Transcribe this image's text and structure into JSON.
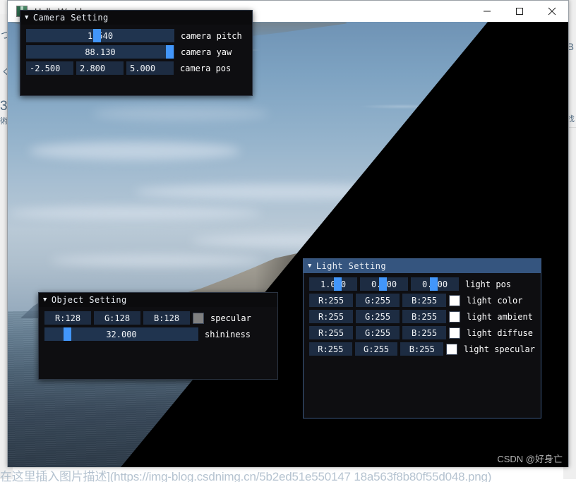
{
  "window": {
    "title": "Hello World",
    "icon": "app-icon",
    "buttons": {
      "minimize": "minimize-icon",
      "maximize": "maximize-icon",
      "close": "close-icon"
    }
  },
  "watermark": "CSDN @好身亡",
  "bottom_caption": "在这里插入图片描述](https://img-blog.csdnimg.cn/5b2ed51e550147 18a563f8b80f55d048.png)",
  "panels": {
    "camera": {
      "title": "Camera Setting",
      "collapse_icon": "triangle-down-icon",
      "rows": [
        {
          "type": "slider",
          "value": "1.540",
          "grab_pct": 45,
          "label": "camera pitch"
        },
        {
          "type": "slider",
          "value": "88.130",
          "grab_pct": 96,
          "label": "camera yaw"
        },
        {
          "type": "fields3",
          "values": [
            "-2.500",
            "2.800",
            "5.000"
          ],
          "label": "camera pos"
        }
      ]
    },
    "object": {
      "title": "Object Setting",
      "collapse_icon": "triangle-down-icon",
      "rows": [
        {
          "type": "rgb",
          "values": [
            "R:128",
            "G:128",
            "B:128"
          ],
          "swatch": "#808080",
          "label": "specular"
        },
        {
          "type": "slider_wide",
          "value": "32.000",
          "grab_pct": 13,
          "label": "shininess"
        }
      ]
    },
    "light": {
      "title": "Light Setting",
      "collapse_icon": "triangle-down-icon",
      "rows": [
        {
          "type": "fields3_drag",
          "values": [
            "1.000",
            "0.000",
            "0.000"
          ],
          "grab_pct": [
            52,
            40,
            40
          ],
          "label": "light pos"
        },
        {
          "type": "rgb",
          "values": [
            "R:255",
            "G:255",
            "B:255"
          ],
          "swatch": "#ffffff",
          "label": "light color"
        },
        {
          "type": "rgb",
          "values": [
            "R:255",
            "G:255",
            "B:255"
          ],
          "swatch": "#ffffff",
          "label": "light ambient"
        },
        {
          "type": "rgb",
          "values": [
            "R:255",
            "G:255",
            "B:255"
          ],
          "swatch": "#ffffff",
          "label": "light diffuse"
        },
        {
          "type": "rgb",
          "values": [
            "R:255",
            "G:255",
            "B:255"
          ],
          "swatch": "#ffffff",
          "label": "light specular"
        }
      ]
    }
  },
  "backdrop": {
    "left_marks": [
      "つ",
      "く",
      "3",
      "術"
    ],
    "right_marks": [
      "B",
      "找"
    ]
  },
  "colors": {
    "accent_blue": "#4296fa",
    "field_bg": "#1d2c42",
    "panel_bg": "#0e0e11",
    "title_active": "#35557f"
  }
}
